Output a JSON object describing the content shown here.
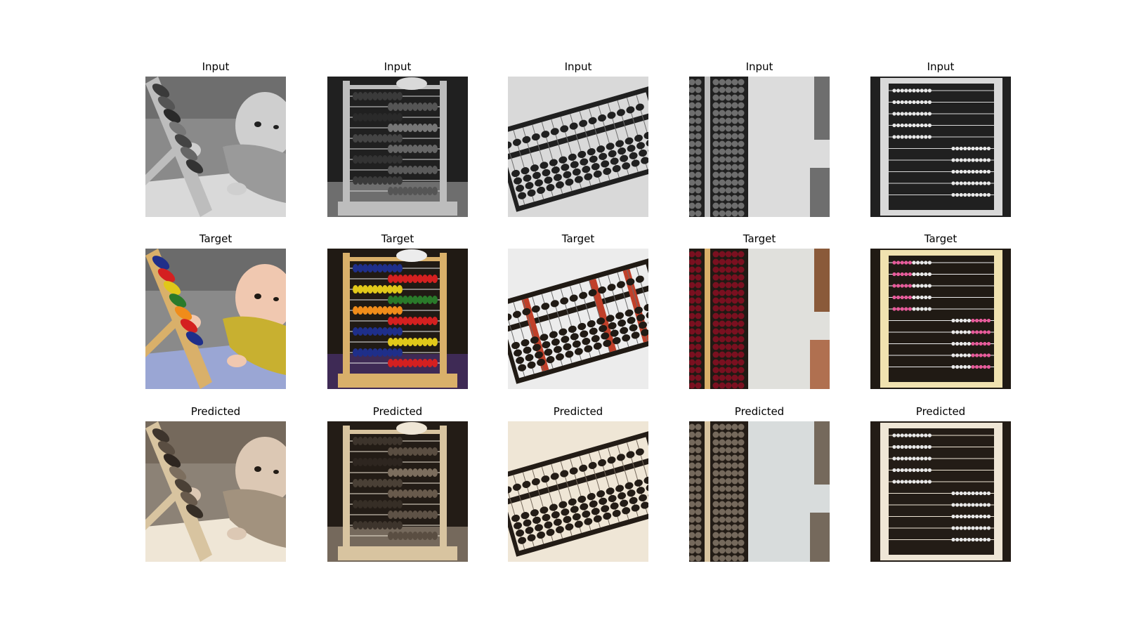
{
  "figure": {
    "columns": 5,
    "rows": [
      {
        "title": "Input",
        "mode": "gray"
      },
      {
        "title": "Target",
        "mode": "color"
      },
      {
        "title": "Predicted",
        "mode": "sepia"
      }
    ],
    "images": [
      {
        "subject": "baby-with-toy-abacus"
      },
      {
        "subject": "toy-abacus-upright"
      },
      {
        "subject": "tilted-soroban"
      },
      {
        "subject": "abacus-against-wall"
      },
      {
        "subject": "bead-frame-dark-board"
      }
    ]
  }
}
